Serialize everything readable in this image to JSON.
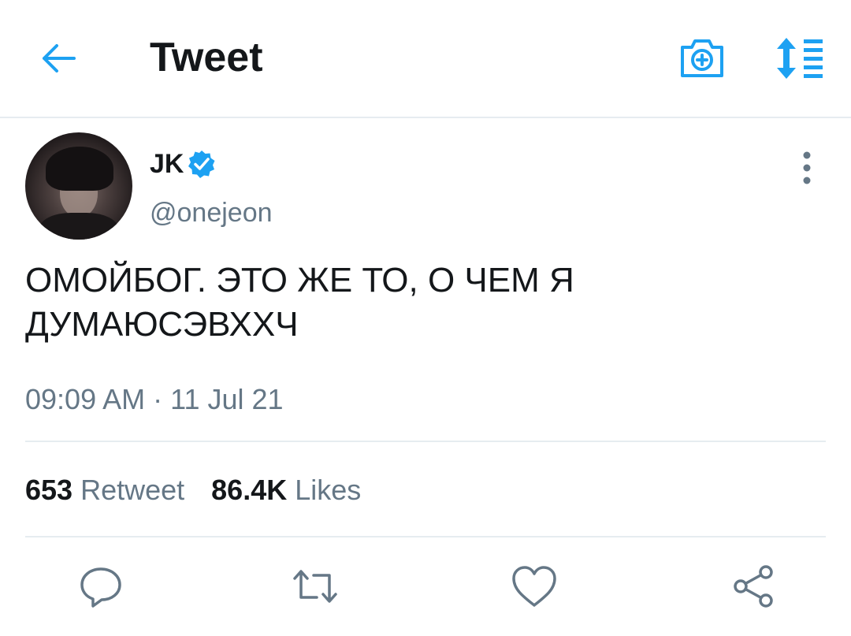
{
  "header": {
    "title": "Tweet",
    "back_icon": "arrow-left-icon",
    "camera_icon": "camera-plus-icon",
    "sort_icon": "sort-list-icon"
  },
  "tweet": {
    "author_name": "JK",
    "verified": true,
    "handle": "@onejeon",
    "text": "ОМОЙБОГ. ЭТО ЖЕ ТО, О ЧЕМ Я ДУМАЮСЭВХХЧ",
    "timestamp": "09:09 AM · 11 Jul 21"
  },
  "stats": {
    "retweets_count": "653",
    "retweets_label": "Retweet",
    "likes_count": "86.4K",
    "likes_label": "Likes"
  },
  "actions": [
    "reply-icon",
    "retweet-icon",
    "like-heart-icon",
    "share-icon"
  ],
  "colors": {
    "accent": "#1da1f2",
    "text_primary": "#14171a",
    "text_secondary": "#657786",
    "divider": "#e6ecf0"
  }
}
